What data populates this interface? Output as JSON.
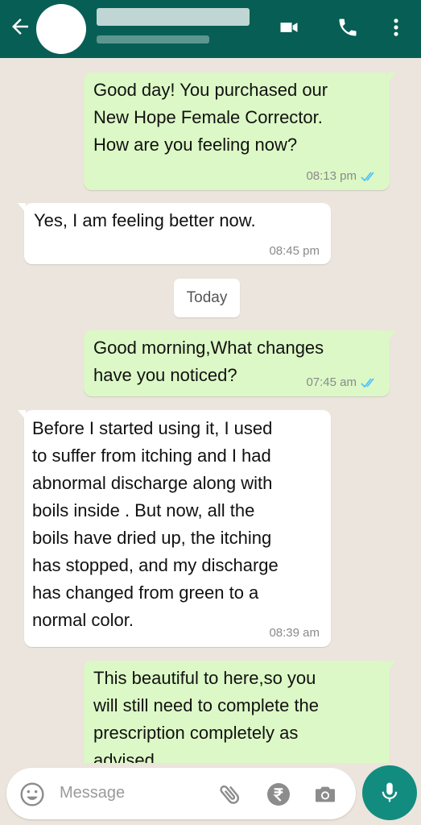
{
  "header": {
    "back_icon": "arrow-left-icon",
    "actions": [
      "video-call-icon",
      "voice-call-icon",
      "more-vertical-icon"
    ]
  },
  "messages": [
    {
      "direction": "outgoing",
      "lines": [
        "Good day! You purchased our",
        "New Hope Female Corrector.",
        "How are you feeling now?"
      ],
      "time": "08:13 pm",
      "status": "read"
    },
    {
      "direction": "incoming",
      "lines": [
        "Yes, I am feeling better now."
      ],
      "time": "08:45 pm"
    },
    {
      "direction": "outgoing",
      "lines": [
        "Good morning,What changes",
        "have you noticed?"
      ],
      "time": "07:45 am",
      "status": "read"
    },
    {
      "direction": "incoming",
      "lines": [
        "Before I started using it, I used",
        "to suffer from itching and I had",
        "abnormal discharge along with",
        "boils inside . But now, all the",
        "boils have dried up, the itching",
        "has stopped, and my discharge",
        "has changed from green to a",
        "normal color."
      ],
      "time": "08:39 am"
    },
    {
      "direction": "outgoing",
      "lines": [
        "This beautiful to here,so you",
        "will still need to complete the",
        "prescription completely as",
        "advised"
      ]
    }
  ],
  "date_separator": "Today",
  "input": {
    "placeholder": "Message",
    "icons": [
      "emoji-icon",
      "attach-icon",
      "rupee-payment-icon",
      "camera-icon"
    ]
  },
  "send_button_icon": "mic-icon",
  "colors": {
    "header": "#075e54",
    "chat_background": "#ece5dd",
    "outgoing_bubble": "#dcf8c6",
    "incoming_bubble": "#ffffff",
    "read_ticks": "#4fc3f7",
    "mic_button": "#128c7e"
  }
}
